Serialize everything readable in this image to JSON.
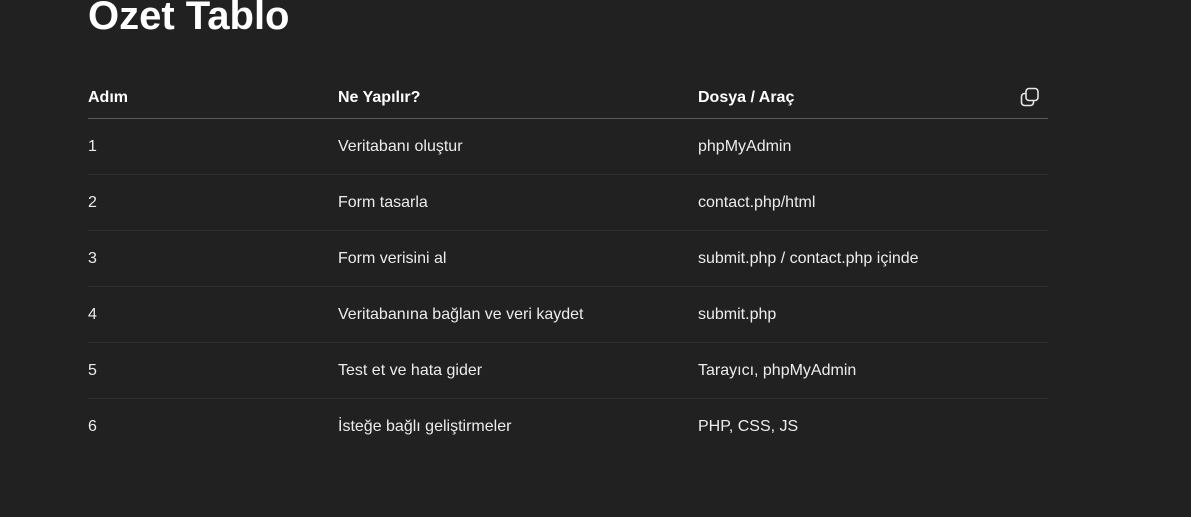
{
  "title": "Özet Tablo",
  "table": {
    "headers": [
      "Adım",
      "Ne Yapılır?",
      "Dosya / Araç"
    ],
    "rows": [
      [
        "1",
        "Veritabanı oluştur",
        "phpMyAdmin"
      ],
      [
        "2",
        "Form tasarla",
        "contact.php/html"
      ],
      [
        "3",
        "Form verisini al",
        "submit.php / contact.php içinde"
      ],
      [
        "4",
        "Veritabanına bağlan ve veri kaydet",
        "submit.php"
      ],
      [
        "5",
        "Test et ve hata gider",
        "Tarayıcı, phpMyAdmin"
      ],
      [
        "6",
        "İsteğe bağlı geliştirmeler",
        "PHP, CSS, JS"
      ]
    ]
  },
  "icons": {
    "copy": "copy-icon"
  },
  "colors": {
    "background": "#212121",
    "text": "#ececec",
    "header_rule": "#5a5a5a",
    "row_rule": "#2e2e2e"
  }
}
